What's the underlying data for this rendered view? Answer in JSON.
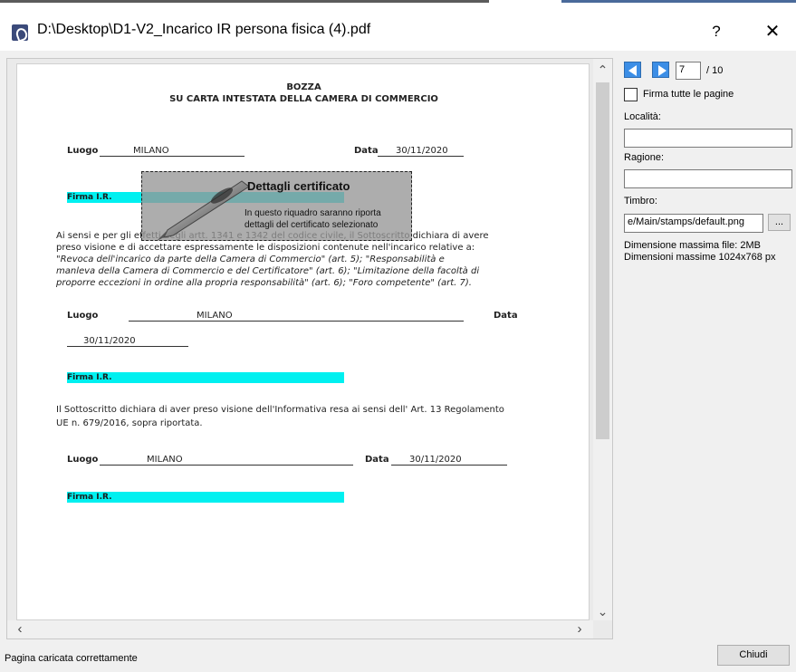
{
  "window": {
    "title": "D:\\Desktop\\D1-V2_Incarico IR persona fisica (4).pdf",
    "help_label": "?",
    "close_label": "✕"
  },
  "document": {
    "heading1": "BOZZA",
    "heading2": "SU CARTA INTESTATA DELLA CAMERA DI COMMERCIO",
    "row1": {
      "luogo_label": "Luogo",
      "luogo_value": "MILANO",
      "data_label": "Data",
      "data_value": "30/11/2020"
    },
    "firma_label_1": "Firma I.R.",
    "para1": [
      "Ai sensi e per gli effetti degli artt. 1341 e 1342 del codice civile, il Sottoscritto dichiara di avere",
      "preso visione e di accettare espressamente le disposizioni contenute nell'incarico relative a:",
      "\"Revoca dell'incarico da parte della Camera di Commercio\" (art. 5); \"Responsabilità e",
      "manleva della Camera di Commercio e del Certificatore\" (art. 6); \"Limitazione della facoltà di",
      "proporre eccezioni in ordine alla propria responsabilità\" (art. 6); \"Foro competente\" (art. 7)."
    ],
    "row2": {
      "luogo_label": "Luogo",
      "luogo_value": "MILANO",
      "data_label": "Data",
      "data_value": "30/11/2020"
    },
    "firma_label_2": "Firma I.R.",
    "para2": [
      "Il Sottoscritto dichiara di aver preso visione dell'Informativa resa ai sensi dell' Art. 13 Regolamento",
      "UE n. 679/2016, sopra riportata."
    ],
    "row3": {
      "luogo_label": "Luogo",
      "luogo_value": "MILANO",
      "data_label": "Data",
      "data_value": "30/11/2020"
    },
    "firma_label_3": "Firma I.R."
  },
  "certificate_overlay": {
    "title": "Dettagli certificato",
    "line1": "In questo riquadro saranno riporta",
    "line2": "dettagli del certificato selezionato"
  },
  "side_panel": {
    "current_page": "7",
    "total_pages": "/ 10",
    "sign_all_label": "Firma tutte le pagine",
    "localita_label": "Località:",
    "localita_value": "",
    "ragione_label": "Ragione:",
    "ragione_value": "",
    "timbro_label": "Timbro:",
    "timbro_value": "e/Main/stamps/default.png",
    "browse_label": "...",
    "max_file_size": "Dimensione massima file: 2MB",
    "max_dimensions": "Dimensioni massime 1024x768 px"
  },
  "footer": {
    "status": "Pagina caricata correttamente",
    "close_button": "Chiudi"
  },
  "colors": {
    "nav_blue": "#3c8ee6",
    "highlight_cyan": "#00f0f0"
  }
}
